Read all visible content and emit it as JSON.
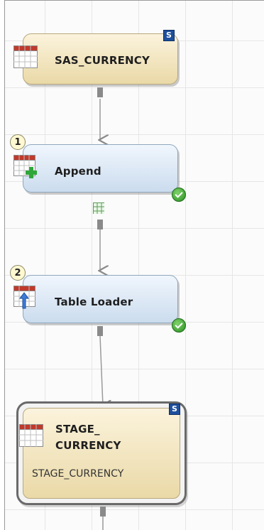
{
  "nodes": {
    "source": {
      "label": "SAS_CURRENCY",
      "badge": "S"
    },
    "append": {
      "label": "Append",
      "order": "1"
    },
    "loader": {
      "label": "Table Loader",
      "order": "2"
    },
    "target": {
      "label_line1": "STAGE_",
      "label_line2": "CURRENCY",
      "sublabel": "STAGE_CURRENCY",
      "badge": "S"
    }
  },
  "colors": {
    "table_node": "#ead9a7",
    "transform_node": "#cbdcee",
    "grid": "#e6e6e6",
    "badge_blue": "#1e4f9c",
    "success_green": "#2a8f22"
  }
}
